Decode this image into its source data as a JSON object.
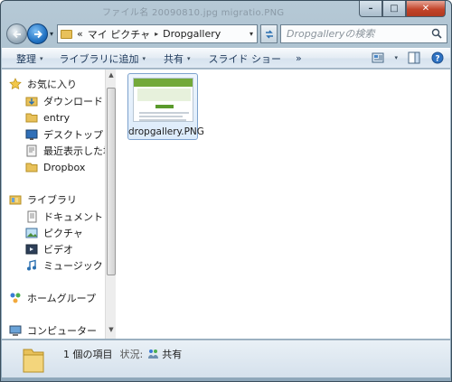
{
  "window": {
    "faded_title": "ファイル名  20090810.jpg  migratio.PNG",
    "buttons": {
      "minimize": "–",
      "maximize": "□",
      "close": "✕"
    }
  },
  "address_bar": {
    "overflow": "«",
    "crumbs": [
      "マイ ピクチャ",
      "Dropgallery"
    ],
    "separator": "▸",
    "dropdown": "▾"
  },
  "search": {
    "placeholder": "Dropgalleryの検索"
  },
  "toolbar": {
    "organize": "整理",
    "add_to_library": "ライブラリに追加",
    "share": "共有",
    "slideshow": "スライド ショー",
    "more": "»",
    "dropdown": "▾"
  },
  "nav_pane": {
    "favorites": "お気に入り",
    "favorite_items": [
      "ダウンロード",
      "entry",
      "デスクトップ",
      "最近表示した場所",
      "Dropbox"
    ],
    "libraries": "ライブラリ",
    "library_items": [
      "ドキュメント",
      "ピクチャ",
      "ビデオ",
      "ミュージック"
    ],
    "homegroup": "ホームグループ",
    "computer": "コンピューター",
    "scroll_up": "▲",
    "scroll_down": "▼"
  },
  "files": [
    {
      "name": "dropgallery.PNG",
      "selected": true
    }
  ],
  "status": {
    "count": "1 個の項目",
    "state_label": "状況:",
    "state_value": "共有"
  },
  "colors": {
    "folder": "#e8c15a",
    "toolbar_text": "#1e395b",
    "selection_border": "#7da2ce"
  }
}
